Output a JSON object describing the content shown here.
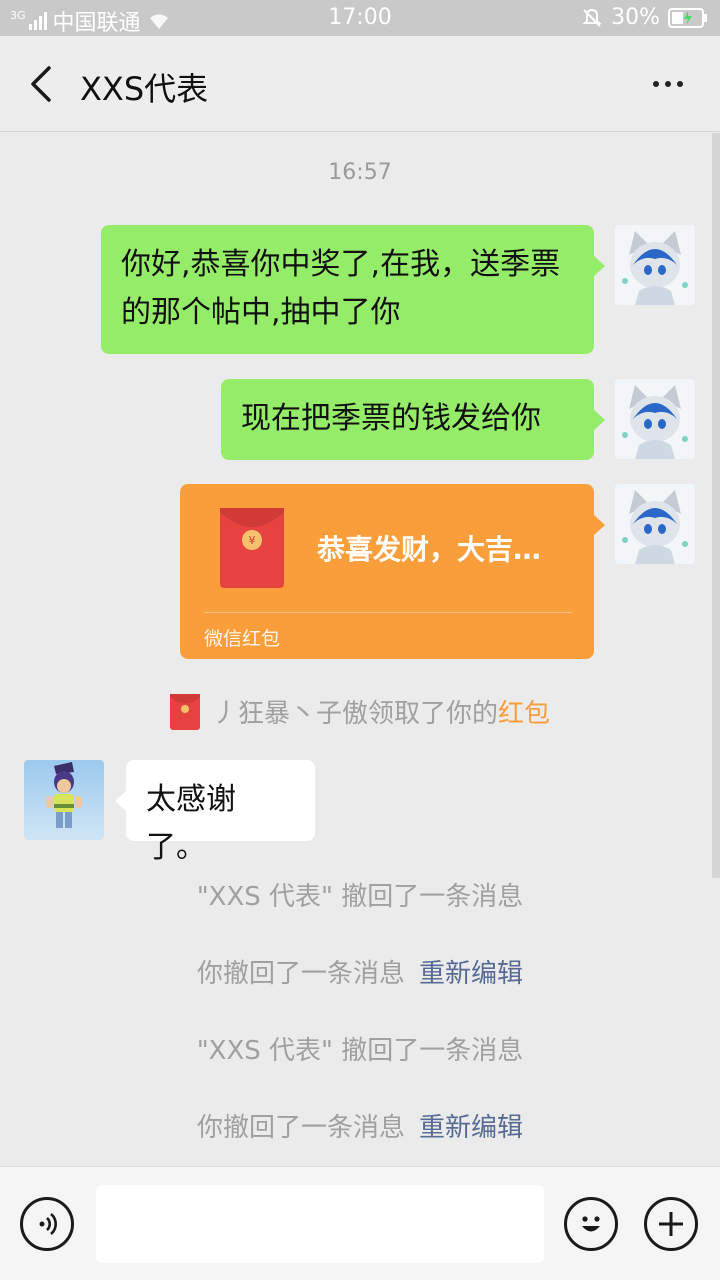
{
  "status_bar": {
    "network_badge": "3G",
    "carrier": "中国联通",
    "time": "17:00",
    "battery": "30%"
  },
  "header": {
    "title": "XXS代表",
    "back_icon": "chevron-left-icon",
    "more_icon": "more-dots-icon"
  },
  "chat": {
    "timestamp": "16:57",
    "messages": [
      {
        "text": "你好,恭喜你中奖了,在我，送季票的那个帖中,抽中了你"
      },
      {
        "text": "现在把季票的钱发给你"
      }
    ],
    "red_packet": {
      "greeting": "恭喜发财，大吉…",
      "label": "微信红包"
    },
    "claim_notice": {
      "prefix": "丿狂暴丶子傲领取了你的",
      "highlight": "红包"
    },
    "reply": {
      "text": "太感谢了。"
    },
    "system_lines": [
      {
        "text": "\"XXS 代表\" 撤回了一条消息",
        "link": ""
      },
      {
        "text": "你撤回了一条消息",
        "link": "重新编辑"
      },
      {
        "text": "\"XXS 代表\" 撤回了一条消息",
        "link": ""
      },
      {
        "text": "你撤回了一条消息",
        "link": "重新编辑"
      }
    ]
  },
  "input_bar": {
    "voice_icon": "voice-icon",
    "emoji_icon": "emoji-icon",
    "plus_icon": "plus-icon"
  },
  "colors": {
    "sent_bubble": "#95ec69",
    "received_bubble": "#ffffff",
    "red_packet": "#fa9d3b",
    "link": "#576b95",
    "background": "#ebebeb"
  }
}
